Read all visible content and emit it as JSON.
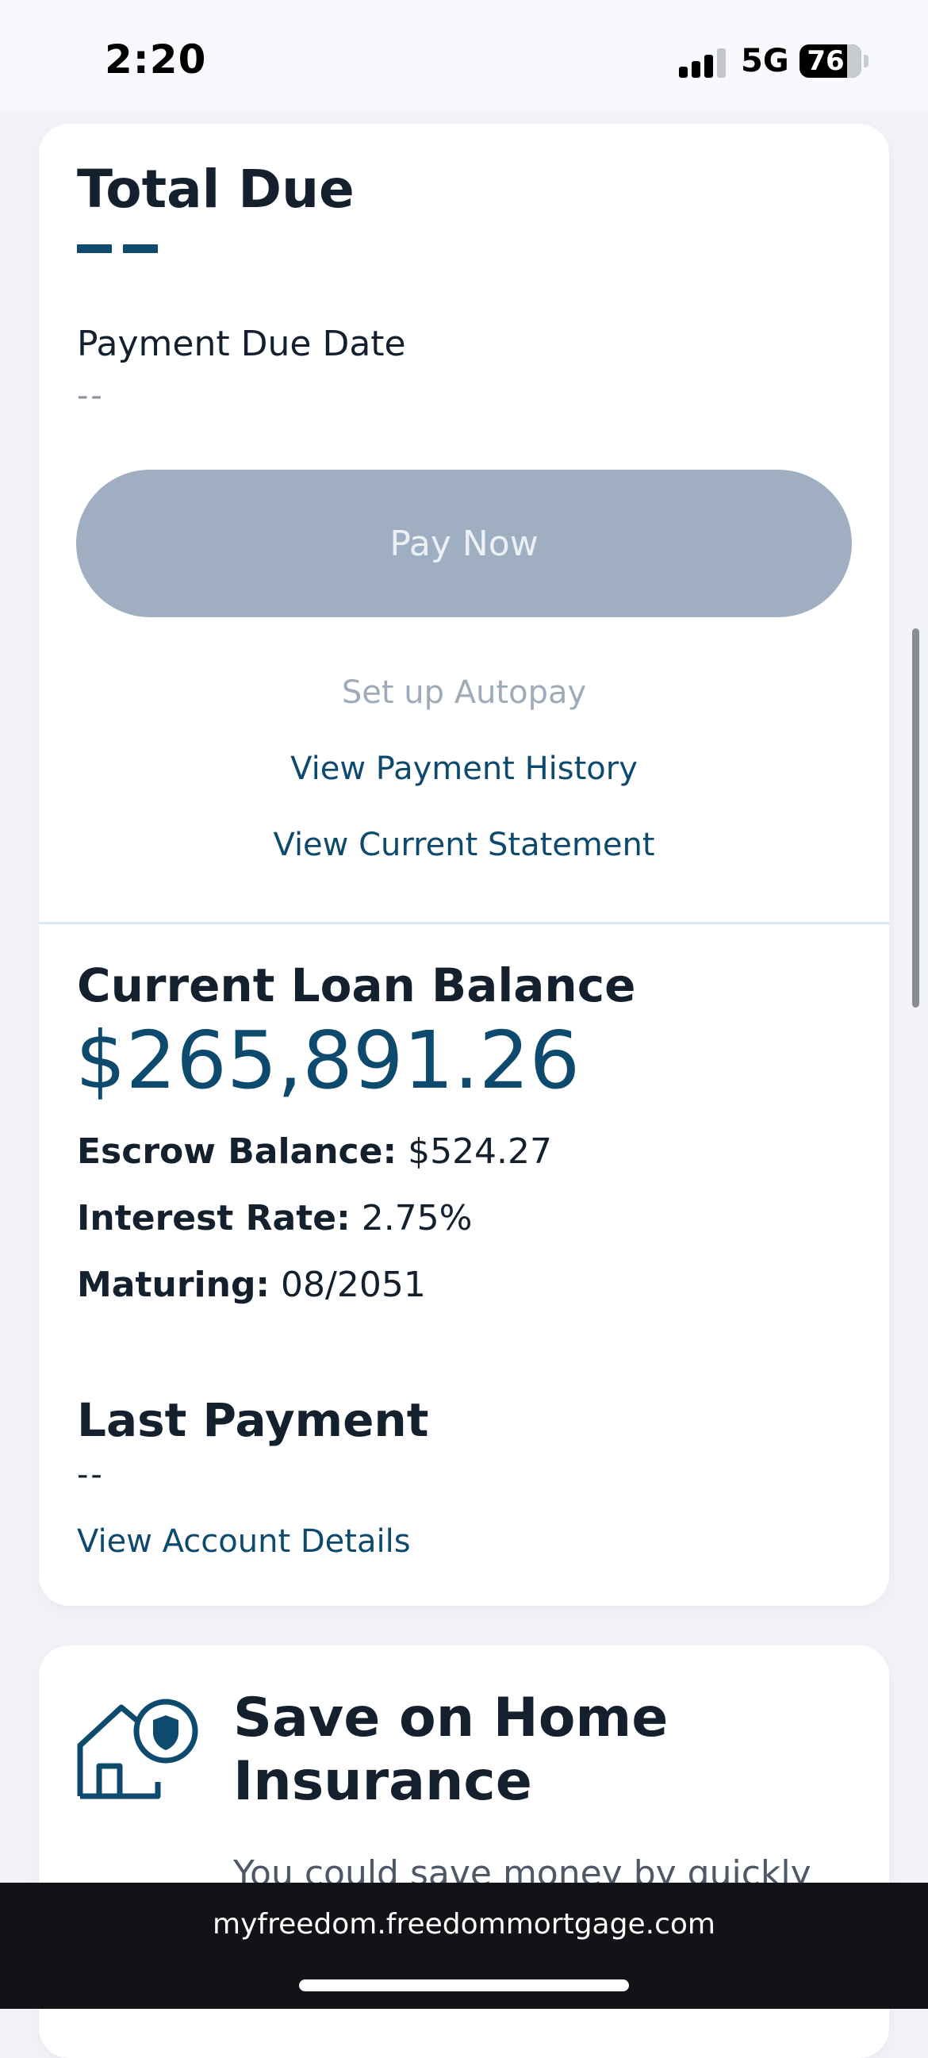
{
  "status_bar": {
    "time": "2:20",
    "network": "5G",
    "battery": "76"
  },
  "payment": {
    "total_due_title": "Total Due",
    "due_date_label": "Payment Due Date",
    "due_date_value": "--",
    "pay_now_label": "Pay Now",
    "autopay_label": "Set up Autopay",
    "history_label": "View Payment History",
    "statement_label": "View Current Statement"
  },
  "loan": {
    "balance_title": "Current Loan Balance",
    "balance_value": "$265,891.26",
    "escrow_label": "Escrow Balance:",
    "escrow_value": "$524.27",
    "rate_label": "Interest Rate:",
    "rate_value": "2.75%",
    "maturing_label": "Maturing:",
    "maturing_value": "08/2051",
    "last_payment_title": "Last Payment",
    "last_payment_value": "--",
    "account_details_label": "View Account Details"
  },
  "promo": {
    "icon": "house-shield-icon",
    "title_line1": "Save on Home",
    "title_line2": "Insurance",
    "body": "You could save money by quickly"
  },
  "browser": {
    "url": "myfreedom.freedommortgage.com"
  },
  "colors": {
    "brand": "#0d4a6e",
    "text": "#14202e",
    "disabled_button": "#9fafc1",
    "background": "#f3f4f9"
  }
}
